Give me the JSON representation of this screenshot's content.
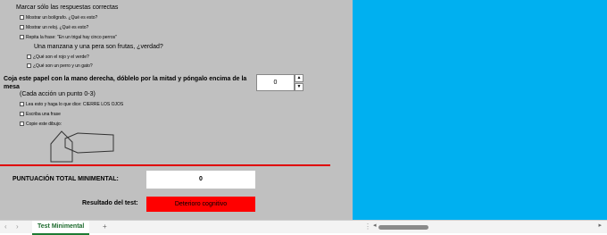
{
  "questions": {
    "header": "Marcar sólo las respuestas correctas",
    "q1": "Mostrar un bolígrafo. ¿Qué es esto?",
    "q2": "Mostrar un reloj. ¿Qué es esto?",
    "q3": "Repita la frase: \"En un trigal hay cinco perros\"",
    "apple_header": "Una manzana y una pera son frutas, ¿verdad?",
    "q4": "¿Qué son el rojo y el verde?",
    "q5": "¿Qué son un perro y un gato?",
    "paper_instruction": "Coja este papel con la mano derecha, dóblelo por la mitad  y póngalo encima de la mesa",
    "each_action": "(Cada acción un punto 0-3)",
    "q6": "Lea esto y haga lo que dice:   CIERRE LOS OJOS",
    "q7": "Escriba una frase",
    "q8": "Copie este dibujo:"
  },
  "stepper": {
    "value": "0",
    "up": "▲",
    "down": "▼"
  },
  "score": {
    "label": "PUNTUACIÓN TOTAL MINIMENTAL:",
    "value": "0"
  },
  "result": {
    "label": "Resultado del test:",
    "value": "Deterioro cognitivo",
    "color": "#ff0000"
  },
  "colors": {
    "right_pane": "#00b0f0",
    "sheet": "#c0c0c0",
    "divider": "#e00000"
  },
  "tabbar": {
    "sheet_tab": "Test Minimental",
    "add": "+",
    "prev": "‹",
    "next": "›",
    "menu": "⋮",
    "scroll_left": "◂",
    "scroll_right": "▸"
  }
}
